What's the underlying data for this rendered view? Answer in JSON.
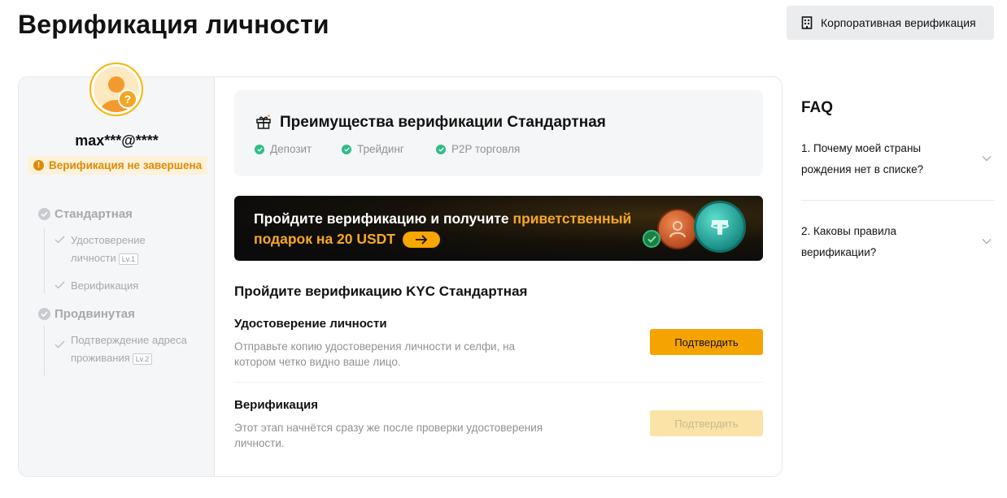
{
  "page": {
    "title": "Верификация личности"
  },
  "header": {
    "corporate_button": "Корпоративная верификация"
  },
  "profile": {
    "username": "max***@****",
    "status": "Верификация не завершена",
    "avatar_badge": "?"
  },
  "levels": [
    {
      "label": "Стандартная",
      "steps": [
        {
          "label": "Удостоверение личности",
          "tag": "Lv.1"
        },
        {
          "label": "Верификация",
          "tag": ""
        }
      ]
    },
    {
      "label": "Продвинутая",
      "steps": [
        {
          "label": "Подтверждение адреса проживания",
          "tag": "Lv.2"
        }
      ]
    }
  ],
  "benefits": {
    "title": "Преимущества верификации Стандартная",
    "items": [
      "Депозит",
      "Трейдинг",
      "P2P торговля"
    ]
  },
  "promo": {
    "text_before": "Пройдите верификацию и получите ",
    "highlight": "приветственный подарок на 20 USDT"
  },
  "kyc": {
    "title": "Пройдите верификацию KYC Стандартная",
    "items": [
      {
        "title": "Удостоверение личности",
        "description": "Отправьте копию удостоверения личности и селфи, на котором четко видно ваше лицо.",
        "button": "Подтвердить",
        "enabled": true
      },
      {
        "title": "Верификация",
        "description": "Этот этап начнётся сразу же после проверки удостоверения личности.",
        "button": "Подтвердить",
        "enabled": false
      }
    ]
  },
  "faq": {
    "title": "FAQ",
    "items": [
      {
        "question": "1. Почему моей страны рождения нет в списке?"
      },
      {
        "question": "2. Каковы правила верификации?"
      }
    ]
  },
  "colors": {
    "accent": "#f5a300",
    "accent_disabled": "#fbe3a7",
    "success": "#2ebd85",
    "warning": "#e08a00"
  },
  "icons": [
    "building-icon",
    "gift-icon",
    "check-circle-icon",
    "arrow-right-icon",
    "chevron-down-icon",
    "warning-icon",
    "usdt-coin-icon"
  ]
}
